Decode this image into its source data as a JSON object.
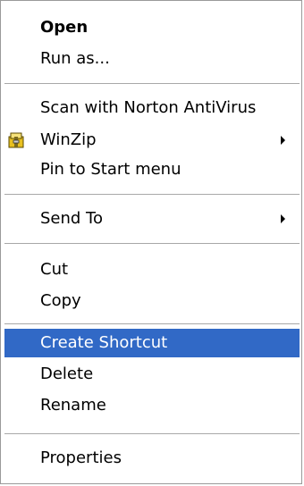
{
  "menu": {
    "items": [
      {
        "label": "Open"
      },
      {
        "label": "Run as..."
      },
      {
        "label": "Scan with Norton AntiVirus"
      },
      {
        "label": "WinZip"
      },
      {
        "label": "Pin to Start menu"
      },
      {
        "label": "Send To"
      },
      {
        "label": "Cut"
      },
      {
        "label": "Copy"
      },
      {
        "label": "Create Shortcut"
      },
      {
        "label": "Delete"
      },
      {
        "label": "Rename"
      },
      {
        "label": "Properties"
      }
    ]
  },
  "icons": {
    "winzip": "winzip-icon",
    "submenu": "submenu-arrow-icon"
  },
  "colors": {
    "selection_background": "#3169c6",
    "selection_text": "#ffffff",
    "separator": "#a8a8a8"
  },
  "state": {
    "highlighted_item": "Create Shortcut"
  }
}
